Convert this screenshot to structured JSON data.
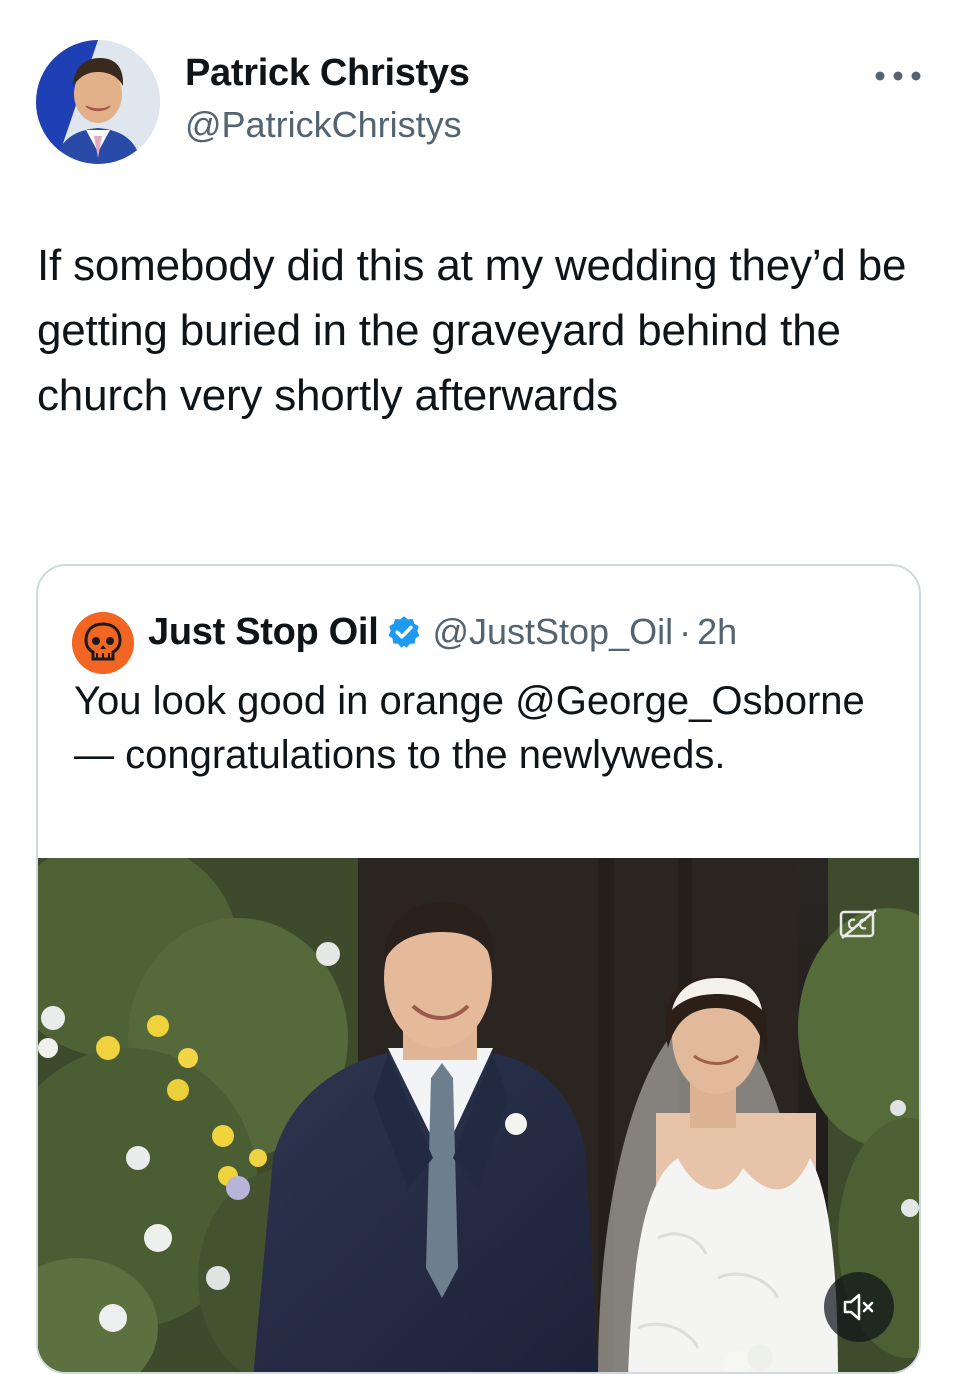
{
  "tweet": {
    "author": {
      "name": "Patrick Christys",
      "handle": "@PatrickChristys"
    },
    "text": "If somebody did this at my wedding they’d be getting buried in the graveyard behind the church very shortly afterwards",
    "more_icon": "ellipsis-icon"
  },
  "quote": {
    "author": {
      "name": "Just Stop Oil",
      "verified_icon": "verified-badge-icon",
      "handle": "@JustStop_Oil",
      "separator": "·",
      "time": "2h"
    },
    "text": "You look good in orange @George_Osborne — congratulations to the newlyweds.",
    "media": {
      "type": "video",
      "captions_icon": "closed-captions-off-icon",
      "mute_icon": "muted-speaker-icon"
    }
  },
  "colors": {
    "text_primary": "#0f1419",
    "text_secondary": "#536471",
    "border": "#cfd9de",
    "verified_blue": "#1d9bf0",
    "brand_orange": "#f26522"
  }
}
